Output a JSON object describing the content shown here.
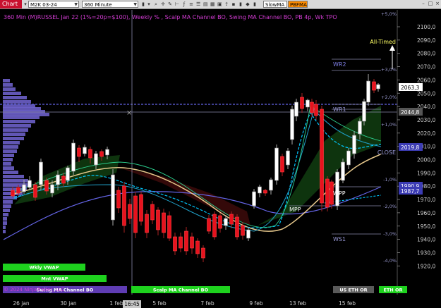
{
  "toolbar": {
    "tab": "Chart",
    "instrument": "M2K 03-24",
    "interval": "360 Minute",
    "btn1": "SlowMA",
    "btn2": "PBFMA"
  },
  "chart": {
    "header": "360 Min (M)RUSSEL Jan 22 (1%=20p=$100), Weekly % , Scalp MA Channel BO, Swing MA Channel BO, PB 4p, Wk TPO",
    "copyright": "© 2024 NinjaTrader, LLC",
    "crosshair_time": "16:45"
  },
  "chart_data": {
    "type": "candlestick",
    "y_axis_ticks": [
      2100,
      2090,
      2080,
      2070,
      2060,
      2050,
      2040,
      2030,
      2020,
      2010,
      2000,
      1990,
      1980,
      1970,
      1960,
      1950,
      1940,
      1930,
      1920
    ],
    "y_axis_labels": [
      "2100,0",
      "2090,0",
      "2080,0",
      "2070,0",
      "2060,0",
      "2050,0",
      "2040,0",
      "2030,0",
      "2020,0",
      "2010,0",
      "2000,0",
      "1990,0",
      "1980,0",
      "1970,0",
      "1960,0",
      "1950,0",
      "1940,0",
      "1930,0",
      "1920,0"
    ],
    "percent_labels": [
      "+5,0%",
      "+3,0%",
      "+2,0%",
      "+1,0%",
      "-1,0%",
      "-2,0%",
      "-3,0%",
      "-4,0%"
    ],
    "x_labels": [
      "26 jan",
      "30 jan",
      "1 feb",
      "5 feb",
      "7 feb",
      "9 feb",
      "13 feb",
      "15 feb"
    ],
    "price_labels": [
      {
        "text": "2063,3",
        "color": "#ffffff",
        "fg": "#000000"
      },
      {
        "text": "2044,8",
        "color": "#555555",
        "fg": "#ffffff"
      },
      {
        "text": "2019,8",
        "color": "#3c3cb4",
        "fg": "#ffffff"
      },
      {
        "text": "1990,9",
        "color": "#3c3cb4",
        "fg": "#ffffff"
      },
      {
        "text": "1987,7",
        "color": "#3c3cb4",
        "fg": "#ffffff"
      }
    ],
    "level_labels": [
      "All-Timed",
      "WR2",
      "WR1",
      "CLOSE",
      "WPP",
      "MPP",
      "WS1"
    ],
    "buttons": [
      "Wkly VWAP",
      "Mnt VWAP",
      "Swing MA Channel BO",
      "Scalp MA Channel BO",
      "US ETH OR",
      "ETH OR"
    ],
    "colors": {
      "bull": "#ffffff",
      "bear": "#e8121e",
      "vwap": "#00c8ff",
      "ma_slow": "#e6c88c",
      "ma_purple": "#6464e6",
      "tpo": "#6b5fc8"
    }
  }
}
